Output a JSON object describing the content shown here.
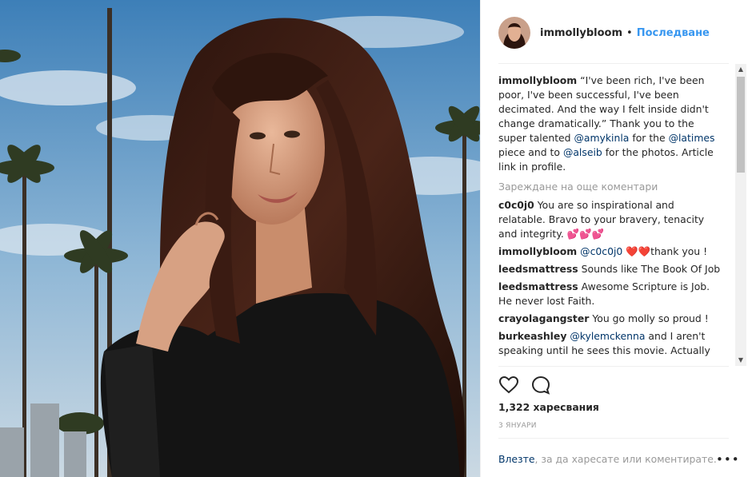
{
  "post": {
    "username": "immollybloom",
    "follow_label": "Последване",
    "separator": "•",
    "caption": {
      "user": "immollybloom",
      "text_1": " “I've been rich, I've been poor, I've been successful, I've been decimated. And the way I felt inside didn't change dramatically.” Thank you to the super talented ",
      "mention_1": "@amykinla",
      "text_2": " for the ",
      "mention_2": "@latimes",
      "text_3": " piece and to ",
      "mention_3": "@alseib",
      "text_4": " for the photos. Article link in profile."
    },
    "load_more": "Зареждане на още коментари",
    "comments": [
      {
        "user": "c0c0j0",
        "text": "You are so inspirational and relatable. Bravo to your bravery, tenacity and integrity. 💕💕💕"
      },
      {
        "user": "immollybloom",
        "mention": "@c0c0j0",
        "text": "❤️❤️thank you !"
      },
      {
        "user": "leedsmattress",
        "text": "Sounds like The Book Of Job"
      },
      {
        "user": "leedsmattress",
        "text": "Awesome Scripture is Job. He never lost Faith."
      },
      {
        "user": "crayolagangster",
        "text": "You go molly so proud !"
      },
      {
        "user": "burkeashley",
        "mention": "@kylemckenna",
        "text": "and I aren't speaking until he sees this movie. Actually"
      }
    ],
    "likes": "1,322 харесвания",
    "date": "3 ЯНУАРИ",
    "login_link": "Влезте",
    "login_text": ", за да харесате или коментирате.",
    "more_icon": "more-options-icon"
  }
}
